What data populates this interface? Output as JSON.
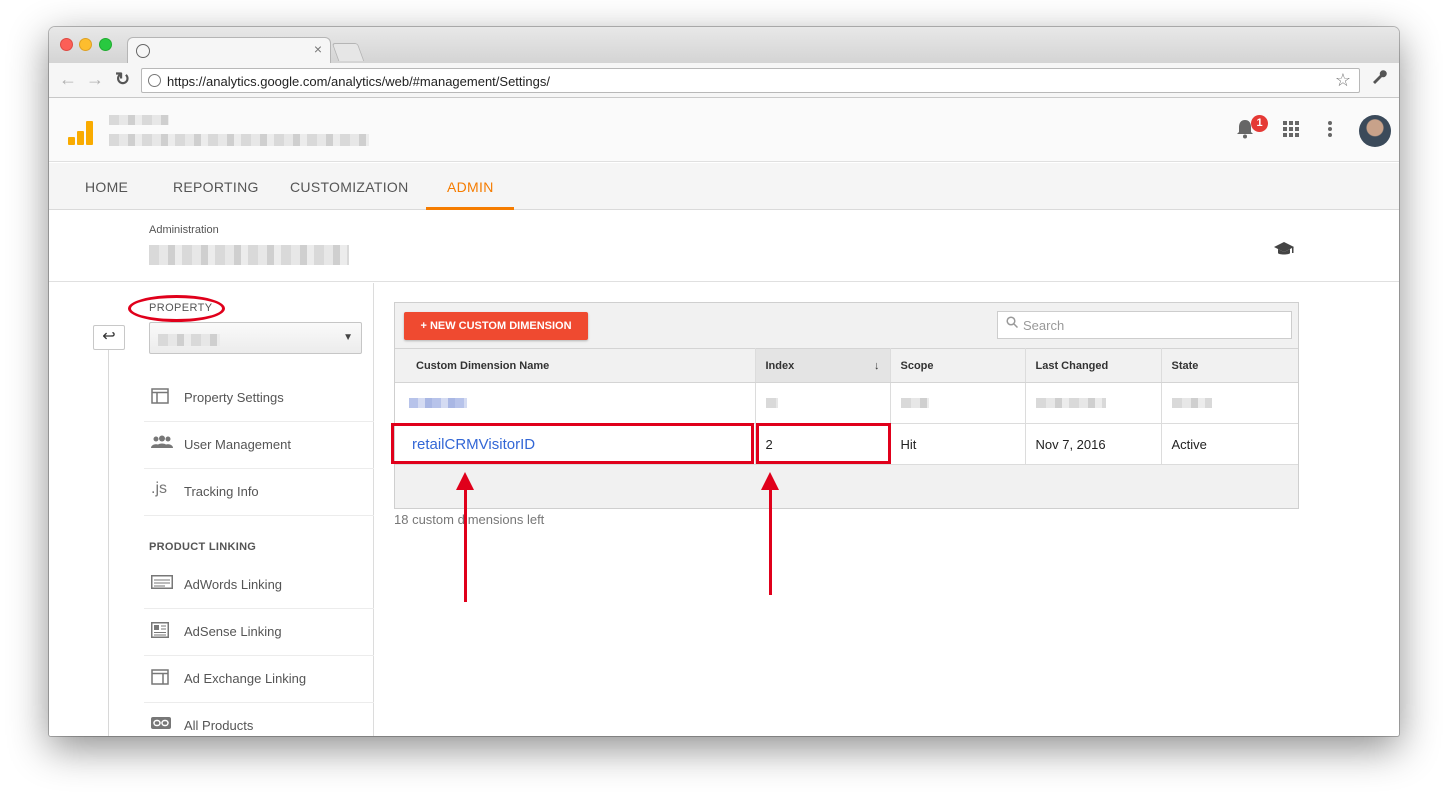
{
  "browser": {
    "url": "https://analytics.google.com/analytics/web/#management/Settings/",
    "tab_close": "×"
  },
  "header": {
    "notification_count": "1"
  },
  "nav": {
    "tabs": [
      {
        "label": "HOME",
        "active": false
      },
      {
        "label": "REPORTING",
        "active": false
      },
      {
        "label": "CUSTOMIZATION",
        "active": false
      },
      {
        "label": "ADMIN",
        "active": true
      }
    ]
  },
  "admin": {
    "label": "Administration"
  },
  "sidebar": {
    "property_label": "PROPERTY",
    "items": [
      {
        "label": "Property Settings",
        "icon": "property-settings-icon"
      },
      {
        "label": "User Management",
        "icon": "users-icon"
      },
      {
        "label": "Tracking Info",
        "icon": "js-icon"
      }
    ],
    "product_linking_label": "PRODUCT LINKING",
    "linking_items": [
      {
        "label": "AdWords Linking",
        "icon": "adwords-icon"
      },
      {
        "label": "AdSense Linking",
        "icon": "adsense-icon"
      },
      {
        "label": "Ad Exchange Linking",
        "icon": "ad-exchange-icon"
      },
      {
        "label": "All Products",
        "icon": "link-icon"
      }
    ]
  },
  "main": {
    "new_button": "+ NEW CUSTOM DIMENSION",
    "search_placeholder": "Search",
    "columns": [
      "Custom Dimension Name",
      "Index",
      "Scope",
      "Last Changed",
      "State"
    ],
    "rows": [
      {
        "name": "",
        "index": "",
        "scope": "",
        "last_changed": "",
        "state": "",
        "redacted": true
      },
      {
        "name": "retailCRMVisitorID",
        "index": "2",
        "scope": "Hit",
        "last_changed": "Nov 7, 2016",
        "state": "Active",
        "redacted": false
      }
    ],
    "footer": "18 custom dimensions left"
  },
  "colors": {
    "accent": "#f57c00",
    "new_button": "#ef4a30",
    "annotation": "#e0001b",
    "link": "#3367d6"
  }
}
